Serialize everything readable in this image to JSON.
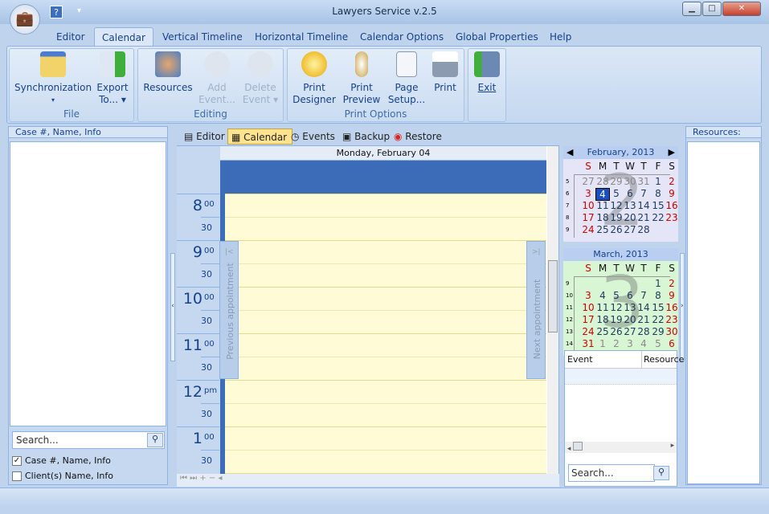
{
  "window": {
    "title": "Lawyers Service v.2.5",
    "minimize": "▁",
    "maximize": "□",
    "close": "✕"
  },
  "qat": {
    "help": "?",
    "dropdown": "▾"
  },
  "ribbon_tabs": [
    "Editor",
    "Calendar",
    "Vertical Timeline",
    "Horizontal Timeline",
    "Calendar Options",
    "Global Properties",
    "Help"
  ],
  "active_tab": "Calendar",
  "groups": {
    "file": "File",
    "editing": "Editing",
    "print": "Print Options"
  },
  "buttons": {
    "sync": "Synchronization",
    "export1": "Export",
    "export2": "To... ▾",
    "resources": "Resources",
    "add1": "Add",
    "add2": "Event...",
    "delete1": "Delete",
    "delete2": "Event ▾",
    "pd1": "Print",
    "pd2": "Designer",
    "pp1": "Print",
    "pp2": "Preview",
    "ps1": "Page",
    "ps2": "Setup...",
    "print": "Print",
    "exit": "Exit"
  },
  "left_panel": {
    "header": "Case #, Name, Info",
    "search_placeholder": "Search...",
    "options": [
      {
        "label": "Case #, Name, Info",
        "checked": true
      },
      {
        "label": "Client(s) Name, Info",
        "checked": false
      }
    ]
  },
  "view_tabs": [
    "Editor",
    "Calendar",
    "Events",
    "Backup",
    "Restore"
  ],
  "day_view": {
    "date_header": "Monday, February 04",
    "prev": "Previous appointment",
    "next": "Next appointment",
    "times": [
      {
        "h": "8",
        "m": "00"
      },
      {
        "h": "9",
        "m": "00"
      },
      {
        "h": "10",
        "m": "00"
      },
      {
        "h": "11",
        "m": "00"
      },
      {
        "h": "12",
        "m": "pm"
      },
      {
        "h": "1",
        "m": "00"
      }
    ],
    "half": "30"
  },
  "mini_calendars": [
    {
      "title": "February, 2013",
      "color": "#e4e6f7",
      "digit": "2",
      "dow": [
        "S",
        "M",
        "T",
        "W",
        "T",
        "F",
        "S"
      ],
      "weeks": [
        5,
        6,
        7,
        8,
        9
      ],
      "days": [
        [
          27,
          28,
          29,
          30,
          31,
          1,
          2
        ],
        [
          3,
          4,
          5,
          6,
          7,
          8,
          9
        ],
        [
          10,
          11,
          12,
          13,
          14,
          15,
          16
        ],
        [
          17,
          18,
          19,
          20,
          21,
          22,
          23
        ],
        [
          24,
          25,
          26,
          27,
          28,
          null,
          null
        ]
      ],
      "selected": 4
    },
    {
      "title": "March, 2013",
      "color": "#d8f5d4",
      "digit": "3",
      "dow": [
        "S",
        "M",
        "T",
        "W",
        "T",
        "F",
        "S"
      ],
      "weeks": [
        9,
        10,
        11,
        12,
        13,
        14
      ],
      "days": [
        [
          null,
          null,
          null,
          null,
          null,
          1,
          2
        ],
        [
          3,
          4,
          5,
          6,
          7,
          8,
          9
        ],
        [
          10,
          11,
          12,
          13,
          14,
          15,
          16
        ],
        [
          17,
          18,
          19,
          20,
          21,
          22,
          23
        ],
        [
          24,
          25,
          26,
          27,
          28,
          29,
          30
        ],
        [
          31,
          1,
          2,
          3,
          4,
          5,
          6
        ]
      ]
    }
  ],
  "events_grid": {
    "columns": [
      "Event",
      "Resource"
    ],
    "search_placeholder": "Search..."
  },
  "resources_panel": {
    "header": "Resources:"
  },
  "colors": {
    "accent": "#3c6bb8",
    "selected": "#1b4fbf",
    "weekend": "#d00000",
    "day_bg": "#fffbd6"
  }
}
